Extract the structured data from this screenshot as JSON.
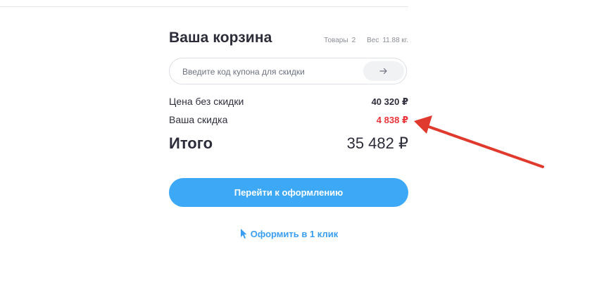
{
  "cart": {
    "title": "Ваша корзина",
    "items_label": "Товары",
    "items_count": "2",
    "weight_label": "Вес",
    "weight_value": "11.88 кг."
  },
  "coupon": {
    "placeholder": "Введите код купона для скидки",
    "submit_icon": "arrow-right-icon"
  },
  "summary": {
    "price_label": "Цена без скидки",
    "price_value": "40 320 ₽",
    "discount_label": "Ваша скидка",
    "discount_value": "4 838 ₽",
    "total_label": "Итого",
    "total_value": "35 482 ₽"
  },
  "actions": {
    "checkout_label": "Перейти к оформлению",
    "one_click_label": "Оформить в 1 клик",
    "one_click_icon": "cursor-pointer-icon"
  },
  "colors": {
    "accent": "#3ca8f6",
    "discount": "#e8343a",
    "annotation": "#e03a2e"
  }
}
